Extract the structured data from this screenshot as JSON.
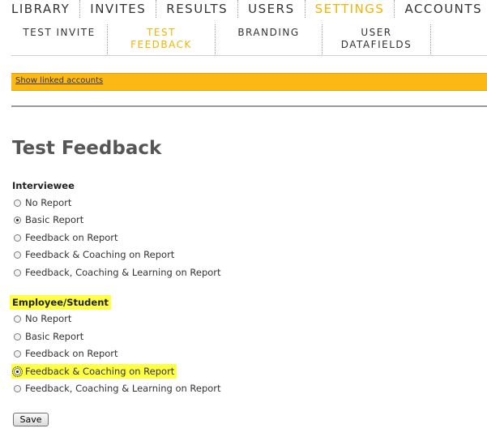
{
  "topnav": {
    "items": [
      {
        "label": "LIBRARY"
      },
      {
        "label": "INVITES"
      },
      {
        "label": "RESULTS"
      },
      {
        "label": "USERS"
      },
      {
        "label": "SETTINGS",
        "active": true
      },
      {
        "label": "ACCOUNTS"
      }
    ]
  },
  "subnav": {
    "items": [
      {
        "line1": "TEST INVITE",
        "line2": ""
      },
      {
        "line1": "TEST",
        "line2": "FEEDBACK",
        "active": true
      },
      {
        "line1": "BRANDING",
        "line2": ""
      },
      {
        "line1": "USER",
        "line2": "DATAFIELDS"
      }
    ]
  },
  "linkbar": {
    "link_label": "Show linked accounts"
  },
  "page": {
    "title": "Test Feedback"
  },
  "interviewee": {
    "label": "Interviewee",
    "options": [
      {
        "label": "No Report",
        "checked": false
      },
      {
        "label": "Basic Report",
        "checked": true
      },
      {
        "label": "Feedback on Report",
        "checked": false
      },
      {
        "label": "Feedback & Coaching on Report",
        "checked": false
      },
      {
        "label": "Feedback, Coaching & Learning on Report",
        "checked": false
      }
    ]
  },
  "employee": {
    "label": "Employee/Student",
    "options": [
      {
        "label": "No Report",
        "checked": false
      },
      {
        "label": "Basic Report",
        "checked": false
      },
      {
        "label": "Feedback on Report",
        "checked": false
      },
      {
        "label": "Feedback & Coaching on Report",
        "checked": true
      },
      {
        "label": "Feedback, Coaching & Learning on Report",
        "checked": false
      }
    ]
  },
  "actions": {
    "save_label": "Save"
  },
  "colors": {
    "accent": "#fcb814",
    "active_text": "#f0b400",
    "highlight": "#ffff44"
  }
}
